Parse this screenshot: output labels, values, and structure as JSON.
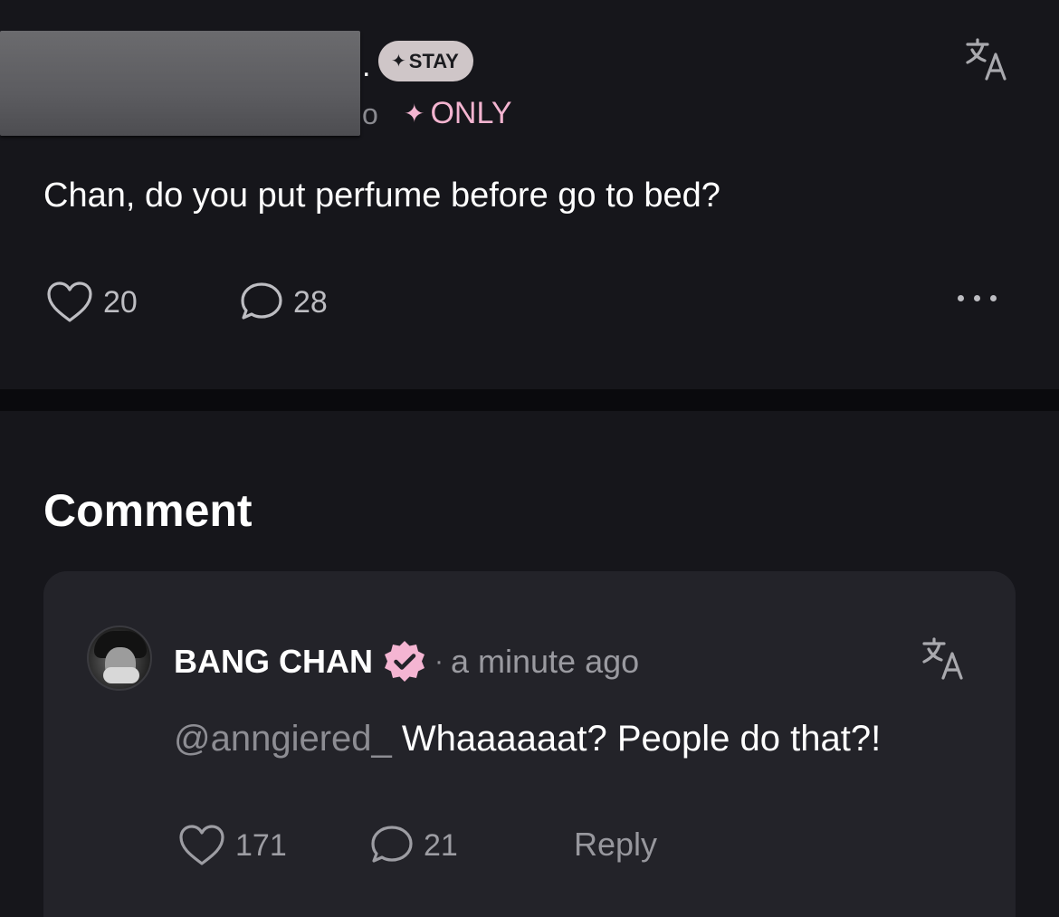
{
  "post": {
    "author_tail": ".",
    "membership_badge": "STAY",
    "meta_tail": "o",
    "only_label": "ONLY",
    "text": "Chan, do you put perfume before go to bed?",
    "likes": "20",
    "comments": "28"
  },
  "comments_section": {
    "title": "Comment",
    "items": [
      {
        "author": "BANG CHAN",
        "separator": "·",
        "time": "a minute ago",
        "mention": "@anngiered_",
        "text": " Whaaaaaat? People do that?!",
        "likes": "171",
        "replies": "21",
        "reply_label": "Reply"
      }
    ]
  },
  "colors": {
    "background": "#16161b",
    "card": "#232329",
    "accent_pink": "#f3b4d0",
    "muted_text": "#9a9aa0"
  },
  "icons": {
    "translate": "translate-icon",
    "like": "heart-outline-icon",
    "comment": "speech-bubble-icon",
    "more": "more-horizontal-icon",
    "verified": "verified-badge-icon",
    "sparkle": "sparkle-icon"
  }
}
